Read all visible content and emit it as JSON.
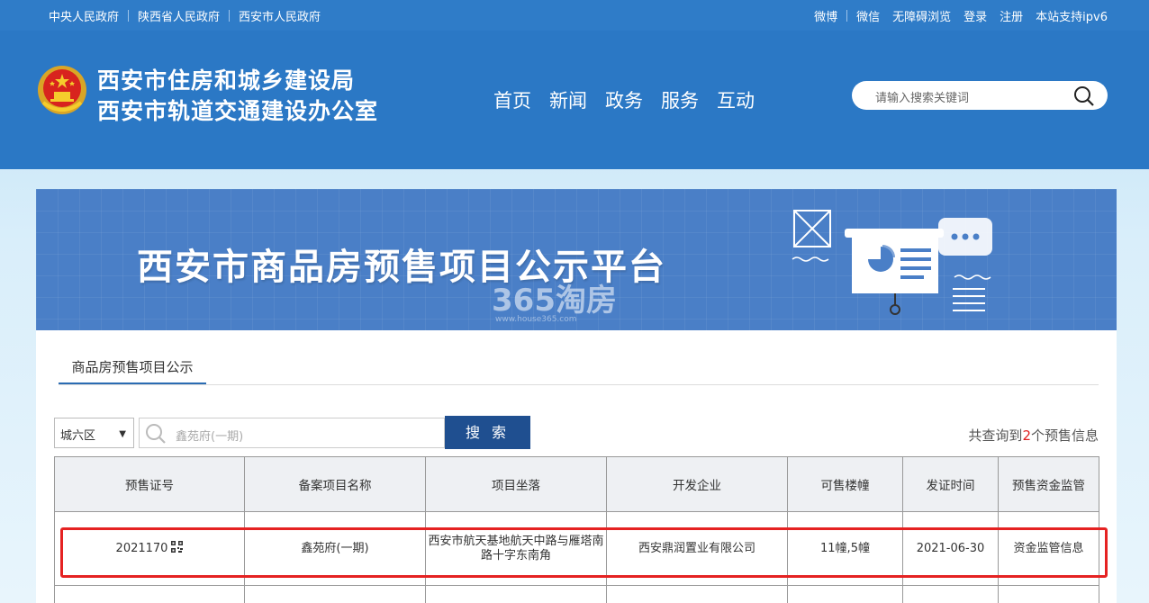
{
  "topbar": {
    "left_links": [
      "中央人民政府",
      "陕西省人民政府",
      "西安市人民政府"
    ],
    "right_links": [
      "微博",
      "微信",
      "无障碍浏览",
      "登录",
      "注册",
      "本站支持ipv6"
    ]
  },
  "header": {
    "title_line1": "西安市住房和城乡建设局",
    "title_line2": "西安市轨道交通建设办公室",
    "nav": [
      "首页",
      "新闻",
      "政务",
      "服务",
      "互动"
    ],
    "search_placeholder": "请输入搜索关键词"
  },
  "banner": {
    "title": "西安市商品房预售项目公示平台",
    "watermark": "365淘房",
    "watermark_url": "www.house365.com"
  },
  "panel": {
    "tab": "商品房预售项目公示",
    "district_selected": "城六区",
    "keyword_value": "鑫苑府(一期)",
    "search_button": "搜 索",
    "count_prefix": "共查询到",
    "count_value": "2",
    "count_suffix": "个预售信息"
  },
  "table": {
    "headers": [
      "预售证号",
      "备案项目名称",
      "项目坐落",
      "开发企业",
      "可售楼幢",
      "发证时间",
      "预售资金监管"
    ],
    "rows": [
      {
        "cert_no": "2021170",
        "project": "鑫苑府(一期)",
        "location": "西安市航天基地航天中路与雁塔南路十字东南角",
        "developer": "西安鼎润置业有限公司",
        "buildings": "11幢,5幢",
        "issue_date": "2021-06-30",
        "supervision": "资金监管信息"
      }
    ]
  },
  "colors": {
    "topbar": "#2f7cc8",
    "header": "#2b78c5",
    "banner": "#4a7fc7",
    "button": "#1f4f90",
    "highlight": "#e52222"
  }
}
